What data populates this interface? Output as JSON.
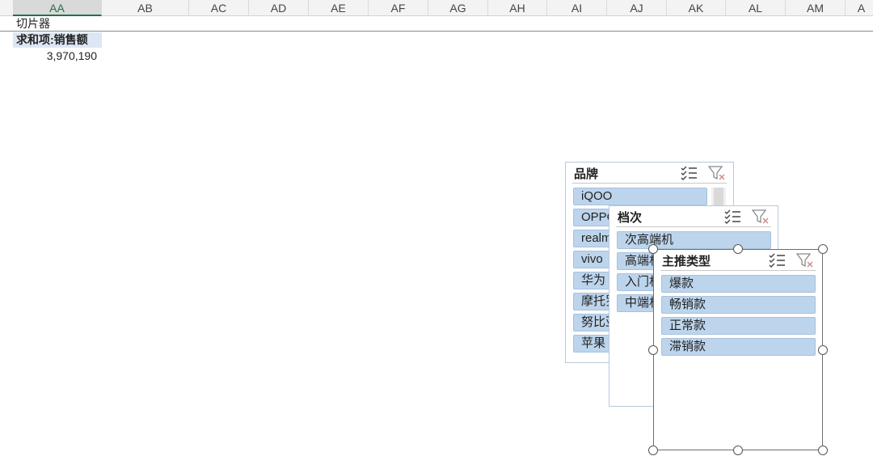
{
  "sheet": {
    "active_column": "AA",
    "columns": [
      "AA",
      "AB",
      "AC",
      "AD",
      "AE",
      "AF",
      "AG",
      "AH",
      "AI",
      "AJ",
      "AK",
      "AL",
      "AM",
      "A"
    ],
    "cells": {
      "label": "切片器",
      "pivot_header": "求和项:销售额",
      "pivot_value": "3,970,190"
    }
  },
  "slicers": {
    "brand": {
      "title": "品牌",
      "items": [
        "iQOO",
        "OPPO",
        "realme",
        "vivo",
        "华为",
        "摩托罗拉",
        "努比亚",
        "苹果"
      ]
    },
    "tier": {
      "title": "档次",
      "items": [
        "次高端机",
        "高端机",
        "入门机",
        "中端机"
      ]
    },
    "type": {
      "title": "主推类型",
      "items": [
        "爆款",
        "畅销款",
        "正常款",
        "滞销款"
      ]
    }
  },
  "icons": {
    "multi_select": "multi-select-icon",
    "clear_filter": "clear-filter-icon"
  },
  "colors": {
    "slicer_item": "#bdd5ec",
    "header_fill": "#dde7f3",
    "active_column": "#217346"
  }
}
